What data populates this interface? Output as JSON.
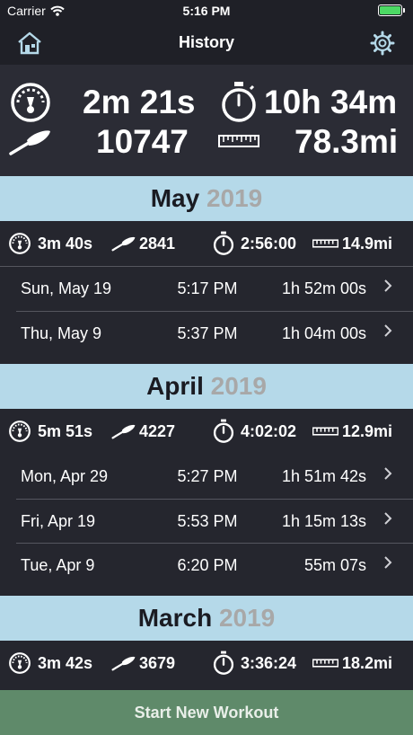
{
  "status": {
    "carrier": "Carrier",
    "time": "5:16 PM"
  },
  "nav": {
    "title": "History"
  },
  "totals": {
    "pace": "2m 21s",
    "duration": "10h 34m",
    "strokes": "10747",
    "distance": "78.3mi"
  },
  "months": [
    {
      "name": "May",
      "year": "2019",
      "summary": {
        "pace": "3m 40s",
        "strokes": "2841",
        "duration": "2:56:00",
        "distance": "14.9mi"
      },
      "workouts": [
        {
          "date": "Sun, May 19",
          "time": "5:17 PM",
          "duration": "1h 52m 00s"
        },
        {
          "date": "Thu, May 9",
          "time": "5:37 PM",
          "duration": "1h 04m 00s"
        }
      ]
    },
    {
      "name": "April",
      "year": "2019",
      "summary": {
        "pace": "5m 51s",
        "strokes": "4227",
        "duration": "4:02:02",
        "distance": "12.9mi"
      },
      "workouts": [
        {
          "date": "Mon, Apr 29",
          "time": "5:27 PM",
          "duration": "1h 51m 42s"
        },
        {
          "date": "Fri, Apr 19",
          "time": "5:53 PM",
          "duration": "1h 15m 13s"
        },
        {
          "date": "Tue, Apr 9",
          "time": "6:20 PM",
          "duration": "55m 07s"
        }
      ]
    },
    {
      "name": "March",
      "year": "2019",
      "summary": {
        "pace": "3m 42s",
        "strokes": "3679",
        "duration": "3:36:24",
        "distance": "18.2mi"
      },
      "workouts": []
    }
  ],
  "footer": {
    "start_label": "Start New Workout"
  },
  "colors": {
    "background": "#25262e",
    "header": "#b5d9e9",
    "button": "#5f8a6a",
    "battery": "#4cd964"
  },
  "icons": [
    "wifi-icon",
    "battery-icon",
    "home-icon",
    "gear-icon",
    "speedometer-icon",
    "stopwatch-icon",
    "oar-icon",
    "ruler-icon",
    "chevron-right-icon"
  ]
}
